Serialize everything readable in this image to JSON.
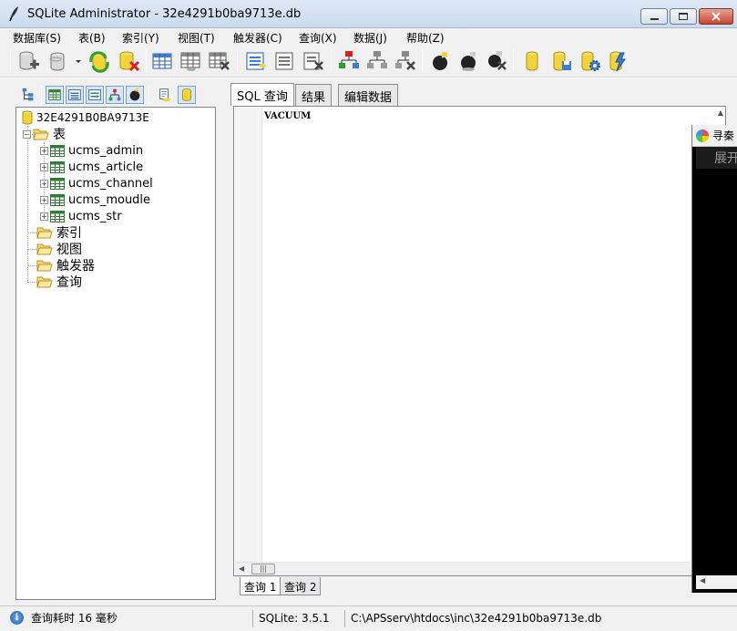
{
  "window": {
    "title": "SQLite Administrator - 32e4291b0ba9713e.db"
  },
  "menu": {
    "items": [
      "数据库(S)",
      "表(B)",
      "索引(Y)",
      "视图(T)",
      "触发器(C)",
      "查询(X)",
      "数据(J)",
      "帮助(Z)"
    ]
  },
  "toolbar": {
    "icons": [
      "add-database-icon",
      "open-database-icon",
      "dropdown-arrow-icon",
      "refresh-database-icon",
      "delete-database-icon",
      "create-table-icon",
      "edit-table-icon",
      "drop-table-icon",
      "create-index-icon",
      "edit-index-icon",
      "drop-index-icon",
      "create-view-icon",
      "edit-view-icon",
      "drop-view-icon",
      "create-trigger-icon",
      "edit-trigger-icon",
      "drop-trigger-icon",
      "new-query-icon",
      "save-query-icon",
      "settings-icon",
      "execute-icon"
    ]
  },
  "tree": {
    "database": "32E4291B0BA9713E",
    "tables_label": "表",
    "tables": [
      "ucms_admin",
      "ucms_article",
      "ucms_channel",
      "ucms_moudle",
      "ucms_str"
    ],
    "indexes_label": "索引",
    "views_label": "视图",
    "triggers_label": "触发器",
    "queries_label": "查询"
  },
  "tabs": {
    "sql": "SQL 查询",
    "results": "结果",
    "edit_data": "编辑数据"
  },
  "editor": {
    "content": "VACUUM"
  },
  "query_tabs": [
    "查询 1",
    "查询 2"
  ],
  "overlay": {
    "title": "寻秦",
    "subtitle": "展开"
  },
  "status": {
    "time": "查询耗时 16 毫秒",
    "version": "SQLite: 3.5.1",
    "path": "C:\\APSserv\\htdocs\\inc\\32e4291b0ba9713e.db"
  },
  "colors": {
    "accent": "#3c7fd2",
    "folder": "#f2c94c",
    "table_icon": "#2e7d32"
  }
}
